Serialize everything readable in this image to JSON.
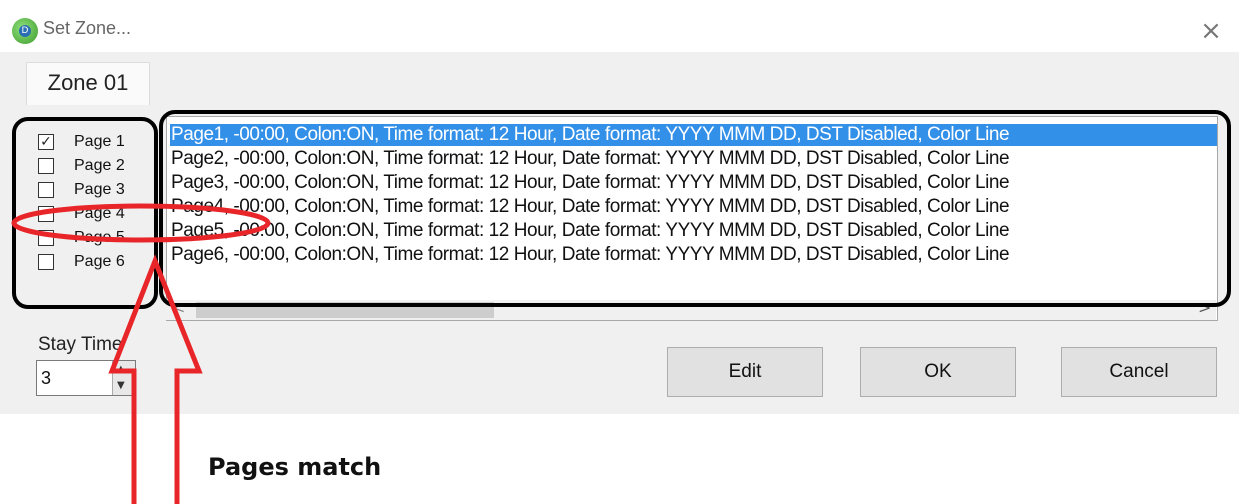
{
  "window": {
    "title": "Set Zone...",
    "close_symbol": "×",
    "app_icon": "app-icon"
  },
  "zone_tab": {
    "label": "Zone 01"
  },
  "pages": [
    {
      "label": "Page 1",
      "checked": true
    },
    {
      "label": "Page 2",
      "checked": false
    },
    {
      "label": "Page 3",
      "checked": false
    },
    {
      "label": "Page 4",
      "checked": false
    },
    {
      "label": "Page 5",
      "checked": false
    },
    {
      "label": "Page 6",
      "checked": false
    }
  ],
  "list_items": [
    "Page1, -00:00, Colon:ON, Time format: 12 Hour, Date format: YYYY MMM DD, DST Disabled, Color Line",
    "Page2, -00:00, Colon:ON, Time format: 12 Hour, Date format: YYYY MMM DD, DST Disabled, Color Line",
    "Page3, -00:00, Colon:ON, Time format: 12 Hour, Date format: YYYY MMM DD, DST Disabled, Color Line",
    "Page4, -00:00, Colon:ON, Time format: 12 Hour, Date format: YYYY MMM DD, DST Disabled, Color Line",
    "Page5, -00:00, Colon:ON, Time format: 12 Hour, Date format: YYYY MMM DD, DST Disabled, Color Line",
    "Page6, -00:00, Colon:ON, Time format: 12 Hour, Date format: YYYY MMM DD, DST Disabled, Color Line"
  ],
  "selected_list_index": 0,
  "scrollbar": {
    "left_arrow": "<",
    "right_arrow": ">"
  },
  "stay_time": {
    "label": "Stay Time",
    "value": "3",
    "up_symbol": "▲",
    "down_symbol": "▼"
  },
  "buttons": {
    "edit": "Edit",
    "ok": "OK",
    "cancel": "Cancel"
  },
  "annotation": {
    "caption": "Pages match",
    "highlight_color": "#e8262a",
    "box_color": "#000000"
  },
  "colors": {
    "selection": "#3390e8",
    "dialog_bg": "#f0f0f0"
  }
}
